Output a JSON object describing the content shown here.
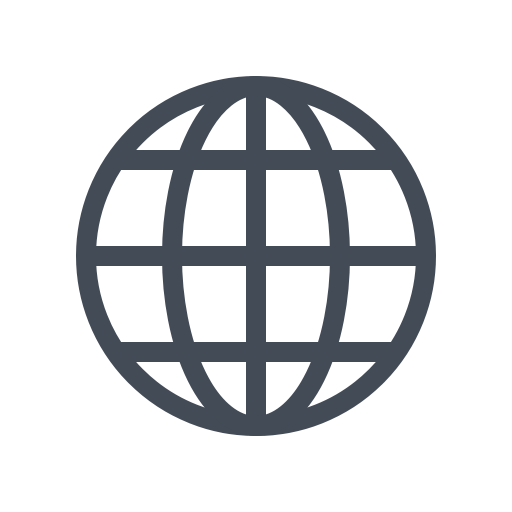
{
  "icon": {
    "name": "globe-icon",
    "color": "#434B57",
    "background": "#FFFFFF"
  }
}
